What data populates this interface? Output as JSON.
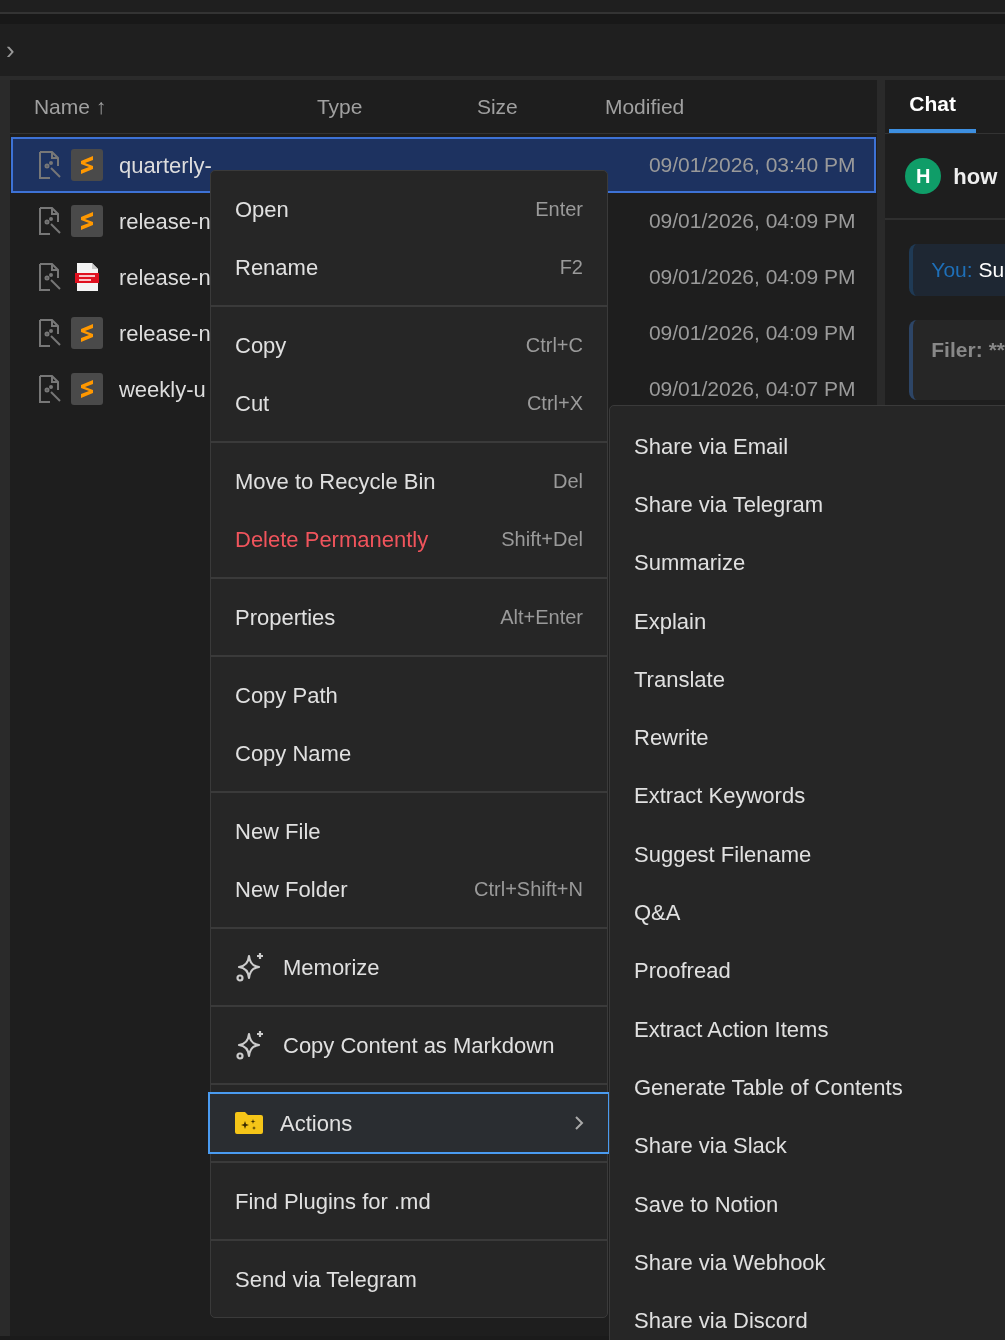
{
  "breadcrumb": {
    "chevron": "›"
  },
  "file_list": {
    "columns": [
      {
        "label": "Name ↑"
      },
      {
        "label": "Type"
      },
      {
        "label": "Size"
      },
      {
        "label": "Modified"
      }
    ],
    "rows": [
      {
        "name": "quarterly-",
        "kind": "markdown",
        "modified": "09/01/2026, 03:40 PM",
        "selected": true
      },
      {
        "name": "release-n",
        "kind": "markdown",
        "modified": "09/01/2026, 04:09 PM",
        "selected": false
      },
      {
        "name": "release-n",
        "kind": "pdf",
        "modified": "09/01/2026, 04:09 PM",
        "selected": false
      },
      {
        "name": "release-n",
        "kind": "markdown",
        "modified": "09/01/2026, 04:09 PM",
        "selected": false
      },
      {
        "name": "weekly-u",
        "kind": "markdown",
        "modified": "09/01/2026, 04:07 PM",
        "selected": false
      }
    ]
  },
  "chat": {
    "tabs": [
      {
        "label": "Chat",
        "selected": true
      }
    ],
    "avatar": "H",
    "title": "how",
    "messages": [
      {
        "kind": "user",
        "speaker": "You:",
        "text": "Su"
      },
      {
        "kind": "bot",
        "speaker": "Filer:",
        "text": "**"
      }
    ]
  },
  "context_menu": {
    "groups": [
      [
        {
          "label": "Open",
          "shortcut": "Enter",
          "kind": "plain",
          "selected": false
        },
        {
          "label": "Rename",
          "shortcut": "F2",
          "kind": "plain",
          "selected": false
        }
      ],
      [
        {
          "label": "Copy",
          "shortcut": "Ctrl+C",
          "kind": "plain",
          "selected": false
        },
        {
          "label": "Cut",
          "shortcut": "Ctrl+X",
          "kind": "plain",
          "selected": false
        }
      ],
      [
        {
          "label": "Move to Recycle Bin",
          "shortcut": "Del",
          "kind": "plain",
          "selected": false
        },
        {
          "label": "Delete Permanently",
          "shortcut": "Shift+Del",
          "kind": "danger",
          "selected": false
        }
      ],
      [
        {
          "label": "Properties",
          "shortcut": "Alt+Enter",
          "kind": "plain",
          "selected": false
        }
      ],
      [
        {
          "label": "Copy Path",
          "kind": "plain",
          "selected": false
        },
        {
          "label": "Copy Name",
          "kind": "plain",
          "selected": false
        }
      ],
      [
        {
          "label": "New File",
          "kind": "plain",
          "selected": false
        },
        {
          "label": "New Folder",
          "shortcut": "Ctrl+Shift+N",
          "kind": "plain",
          "selected": false
        }
      ],
      [
        {
          "label": "Memorize",
          "kind": "sparkle",
          "selected": false
        }
      ],
      [
        {
          "label": "Copy Content as Markdown",
          "kind": "sparkle",
          "selected": false
        }
      ],
      [
        {
          "label": "Actions",
          "kind": "folder",
          "selected": true
        }
      ],
      [
        {
          "label": "Find Plugins for .md",
          "kind": "plain",
          "selected": false
        }
      ],
      [
        {
          "label": "Send via Telegram",
          "kind": "plain",
          "selected": false
        }
      ]
    ]
  },
  "submenu": {
    "items": [
      "Share via Email",
      "Share via Telegram",
      "Summarize",
      "Explain",
      "Translate",
      "Rewrite",
      "Extract Keywords",
      "Suggest Filename",
      "Q&A",
      "Proofread",
      "Extract Action Items",
      "Generate Table of Contents",
      "Share via Slack",
      "Save to Notion",
      "Share via Webhook",
      "Share via Discord"
    ]
  }
}
